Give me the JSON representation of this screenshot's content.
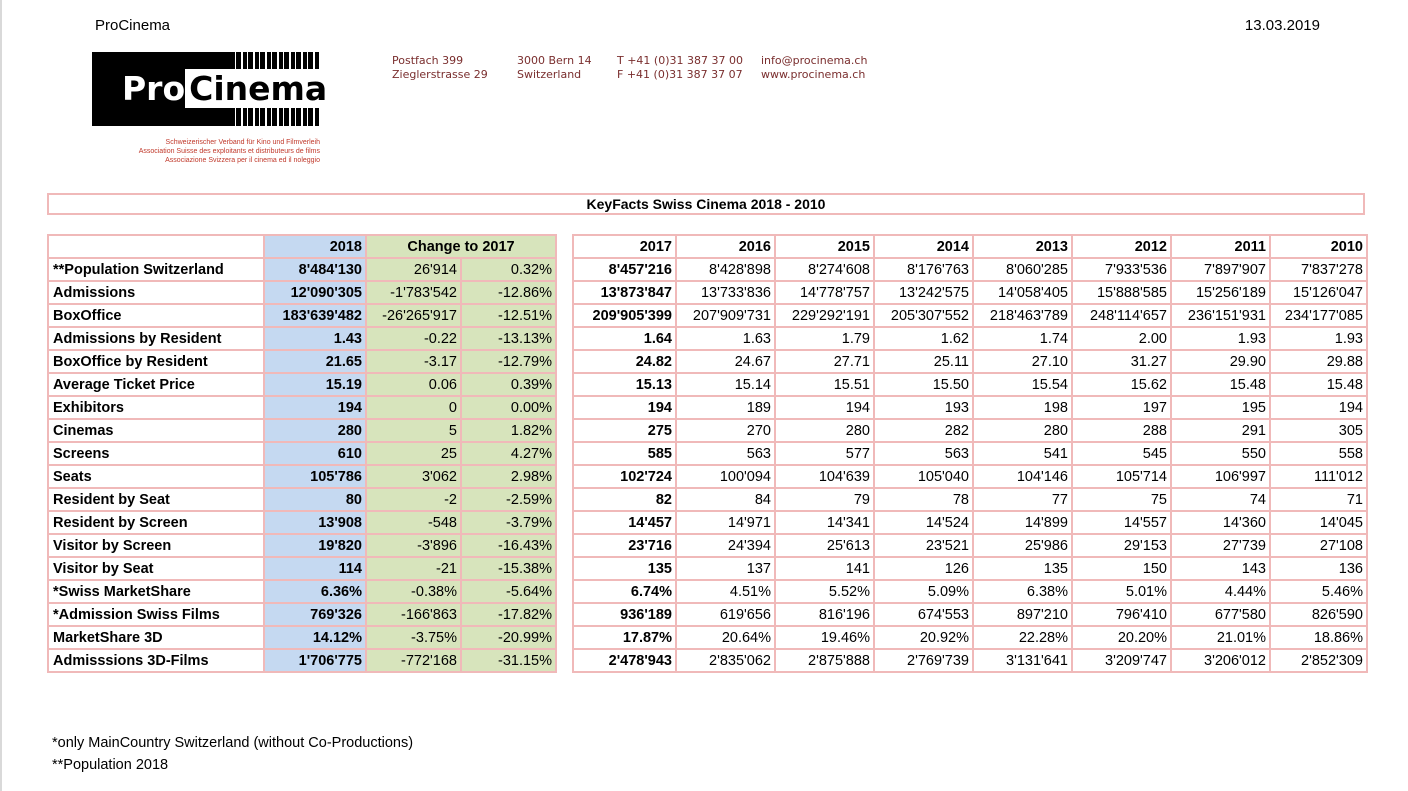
{
  "header": {
    "org_name": "ProCinema",
    "date": "13.03.2019"
  },
  "logo": {
    "word_pro": "Pro",
    "word_cinema": "Cinema",
    "tagline": [
      "Schweizerischer Verband für Kino und Filmverleih",
      "Association Suisse des exploitants et distributeurs de films",
      "Associazione Svizzera per il cinema ed il noleggio"
    ]
  },
  "address": {
    "col1": [
      "Postfach 399",
      "Zieglerstrasse 29"
    ],
    "col2": [
      "3000 Bern 14",
      "Switzerland"
    ],
    "col3": [
      "T +41 (0)31 387 37 00",
      "F +41 (0)31 387 37 07"
    ],
    "col4": [
      "info@procinema.ch",
      "www.procinema.ch"
    ]
  },
  "title": "KeyFacts Swiss Cinema 2018 - 2010",
  "table": {
    "left_headers": {
      "year": "2018",
      "change": "Change to 2017"
    },
    "right_headers": [
      "2017",
      "2016",
      "2015",
      "2014",
      "2013",
      "2012",
      "2011",
      "2010"
    ],
    "rows": [
      {
        "label": "**Population Switzerland",
        "v2018": "8'484'130",
        "chg_abs": "26'914",
        "chg_pct": "0.32%",
        "years": [
          "8'457'216",
          "8'428'898",
          "8'274'608",
          "8'176'763",
          "8'060'285",
          "7'933'536",
          "7'897'907",
          "7'837'278"
        ]
      },
      {
        "label": "Admissions",
        "v2018": "12'090'305",
        "chg_abs": "-1'783'542",
        "chg_pct": "-12.86%",
        "years": [
          "13'873'847",
          "13'733'836",
          "14'778'757",
          "13'242'575",
          "14'058'405",
          "15'888'585",
          "15'256'189",
          "15'126'047"
        ]
      },
      {
        "label": "BoxOffice",
        "v2018": "183'639'482",
        "chg_abs": "-26'265'917",
        "chg_pct": "-12.51%",
        "years": [
          "209'905'399",
          "207'909'731",
          "229'292'191",
          "205'307'552",
          "218'463'789",
          "248'114'657",
          "236'151'931",
          "234'177'085"
        ]
      },
      {
        "label": "Admissions by Resident",
        "v2018": "1.43",
        "chg_abs": "-0.22",
        "chg_pct": "-13.13%",
        "years": [
          "1.64",
          "1.63",
          "1.79",
          "1.62",
          "1.74",
          "2.00",
          "1.93",
          "1.93"
        ]
      },
      {
        "label": "BoxOffice by Resident",
        "v2018": "21.65",
        "chg_abs": "-3.17",
        "chg_pct": "-12.79%",
        "years": [
          "24.82",
          "24.67",
          "27.71",
          "25.11",
          "27.10",
          "31.27",
          "29.90",
          "29.88"
        ]
      },
      {
        "label": "Average Ticket Price",
        "v2018": "15.19",
        "chg_abs": "0.06",
        "chg_pct": "0.39%",
        "years": [
          "15.13",
          "15.14",
          "15.51",
          "15.50",
          "15.54",
          "15.62",
          "15.48",
          "15.48"
        ]
      },
      {
        "label": "Exhibitors",
        "v2018": "194",
        "chg_abs": "0",
        "chg_pct": "0.00%",
        "years": [
          "194",
          "189",
          "194",
          "193",
          "198",
          "197",
          "195",
          "194"
        ]
      },
      {
        "label": "Cinemas",
        "v2018": "280",
        "chg_abs": "5",
        "chg_pct": "1.82%",
        "years": [
          "275",
          "270",
          "280",
          "282",
          "280",
          "288",
          "291",
          "305"
        ]
      },
      {
        "label": "Screens",
        "v2018": "610",
        "chg_abs": "25",
        "chg_pct": "4.27%",
        "years": [
          "585",
          "563",
          "577",
          "563",
          "541",
          "545",
          "550",
          "558"
        ]
      },
      {
        "label": "Seats",
        "v2018": "105'786",
        "chg_abs": "3'062",
        "chg_pct": "2.98%",
        "years": [
          "102'724",
          "100'094",
          "104'639",
          "105'040",
          "104'146",
          "105'714",
          "106'997",
          "111'012"
        ]
      },
      {
        "label": "Resident by Seat",
        "v2018": "80",
        "chg_abs": "-2",
        "chg_pct": "-2.59%",
        "years": [
          "82",
          "84",
          "79",
          "78",
          "77",
          "75",
          "74",
          "71"
        ]
      },
      {
        "label": "Resident by Screen",
        "v2018": "13'908",
        "chg_abs": "-548",
        "chg_pct": "-3.79%",
        "years": [
          "14'457",
          "14'971",
          "14'341",
          "14'524",
          "14'899",
          "14'557",
          "14'360",
          "14'045"
        ]
      },
      {
        "label": "Visitor by Screen",
        "v2018": "19'820",
        "chg_abs": "-3'896",
        "chg_pct": "-16.43%",
        "years": [
          "23'716",
          "24'394",
          "25'613",
          "23'521",
          "25'986",
          "29'153",
          "27'739",
          "27'108"
        ]
      },
      {
        "label": "Visitor by Seat",
        "v2018": "114",
        "chg_abs": "-21",
        "chg_pct": "-15.38%",
        "years": [
          "135",
          "137",
          "141",
          "126",
          "135",
          "150",
          "143",
          "136"
        ]
      },
      {
        "label": "*Swiss MarketShare",
        "v2018": "6.36%",
        "chg_abs": "-0.38%",
        "chg_pct": "-5.64%",
        "years": [
          "6.74%",
          "4.51%",
          "5.52%",
          "5.09%",
          "6.38%",
          "5.01%",
          "4.44%",
          "5.46%"
        ]
      },
      {
        "label": "*Admission Swiss Films",
        "v2018": "769'326",
        "chg_abs": "-166'863",
        "chg_pct": "-17.82%",
        "years": [
          "936'189",
          "619'656",
          "816'196",
          "674'553",
          "897'210",
          "796'410",
          "677'580",
          "826'590"
        ]
      },
      {
        "label": "MarketShare 3D",
        "v2018": "14.12%",
        "chg_abs": "-3.75%",
        "chg_pct": "-20.99%",
        "years": [
          "17.87%",
          "20.64%",
          "19.46%",
          "20.92%",
          "22.28%",
          "20.20%",
          "21.01%",
          "18.86%"
        ]
      },
      {
        "label": "Admisssions 3D-Films",
        "v2018": "1'706'775",
        "chg_abs": "-772'168",
        "chg_pct": "-31.15%",
        "years": [
          "2'478'943",
          "2'835'062",
          "2'875'888",
          "2'769'739",
          "3'131'641",
          "3'209'747",
          "3'206'012",
          "2'852'309"
        ]
      }
    ]
  },
  "notes": [
    "*only MainCountry Switzerland (without Co-Productions)",
    "**Population 2018"
  ]
}
